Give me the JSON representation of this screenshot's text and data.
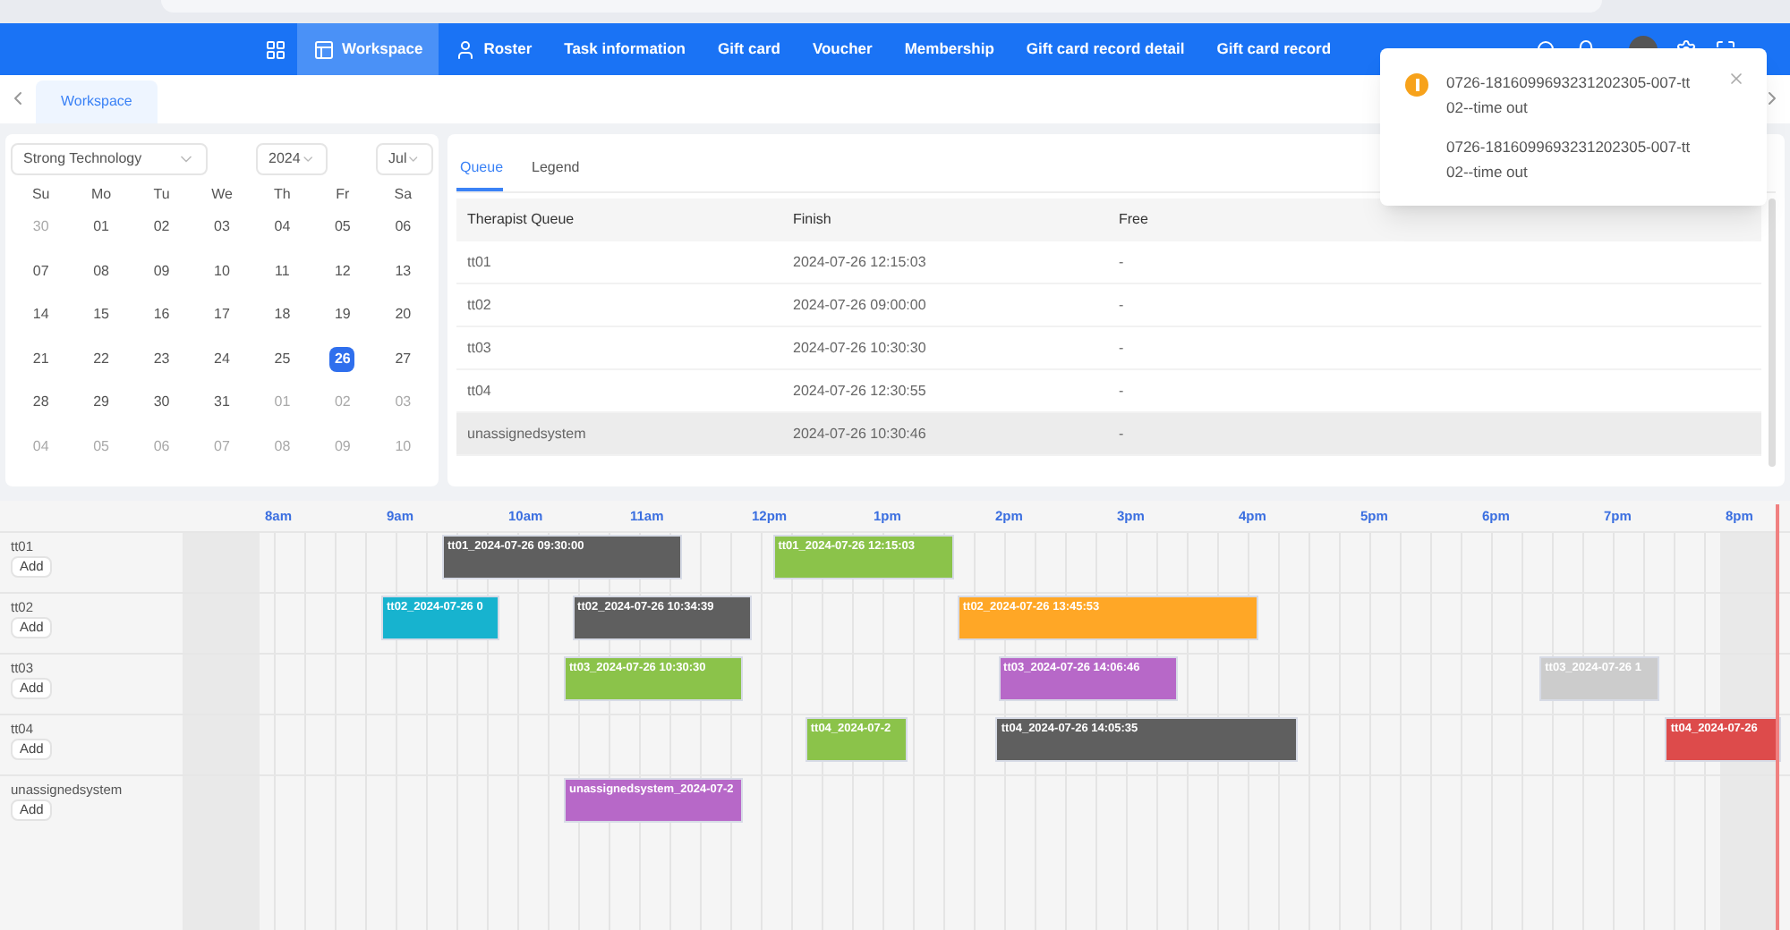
{
  "nav": {
    "items": [
      {
        "label": "Workspace",
        "selected": true,
        "kind": "panel"
      },
      {
        "label": "Roster",
        "selected": false,
        "kind": "person"
      },
      {
        "label": "Task information",
        "selected": false,
        "kind": "plain"
      },
      {
        "label": "Gift card",
        "selected": false,
        "kind": "plain"
      },
      {
        "label": "Voucher",
        "selected": false,
        "kind": "plain"
      },
      {
        "label": "Membership",
        "selected": false,
        "kind": "plain"
      },
      {
        "label": "Gift card record detail",
        "selected": false,
        "kind": "plain"
      },
      {
        "label": "Gift card record",
        "selected": false,
        "kind": "plain"
      }
    ]
  },
  "page_tabs": [
    {
      "label": "Workspace",
      "selected": true
    }
  ],
  "calendar": {
    "store": "Strong Technology",
    "year": "2024",
    "month": "Jul",
    "weekdays": [
      "Su",
      "Mo",
      "Tu",
      "We",
      "Th",
      "Fr",
      "Sa"
    ],
    "weeks": [
      [
        {
          "day": "30",
          "muted": true,
          "selected": false
        },
        {
          "day": "01",
          "muted": false,
          "selected": false
        },
        {
          "day": "02",
          "muted": false,
          "selected": false
        },
        {
          "day": "03",
          "muted": false,
          "selected": false
        },
        {
          "day": "04",
          "muted": false,
          "selected": false
        },
        {
          "day": "05",
          "muted": false,
          "selected": false
        },
        {
          "day": "06",
          "muted": false,
          "selected": false
        }
      ],
      [
        {
          "day": "07",
          "muted": false,
          "selected": false
        },
        {
          "day": "08",
          "muted": false,
          "selected": false
        },
        {
          "day": "09",
          "muted": false,
          "selected": false
        },
        {
          "day": "10",
          "muted": false,
          "selected": false
        },
        {
          "day": "11",
          "muted": false,
          "selected": false
        },
        {
          "day": "12",
          "muted": false,
          "selected": false
        },
        {
          "day": "13",
          "muted": false,
          "selected": false
        }
      ],
      [
        {
          "day": "14",
          "muted": false,
          "selected": false
        },
        {
          "day": "15",
          "muted": false,
          "selected": false
        },
        {
          "day": "16",
          "muted": false,
          "selected": false
        },
        {
          "day": "17",
          "muted": false,
          "selected": false
        },
        {
          "day": "18",
          "muted": false,
          "selected": false
        },
        {
          "day": "19",
          "muted": false,
          "selected": false
        },
        {
          "day": "20",
          "muted": false,
          "selected": false
        }
      ],
      [
        {
          "day": "21",
          "muted": false,
          "selected": false
        },
        {
          "day": "22",
          "muted": false,
          "selected": false
        },
        {
          "day": "23",
          "muted": false,
          "selected": false
        },
        {
          "day": "24",
          "muted": false,
          "selected": false
        },
        {
          "day": "25",
          "muted": false,
          "selected": false
        },
        {
          "day": "26",
          "muted": false,
          "selected": true
        },
        {
          "day": "27",
          "muted": false,
          "selected": false
        }
      ],
      [
        {
          "day": "28",
          "muted": false,
          "selected": false
        },
        {
          "day": "29",
          "muted": false,
          "selected": false
        },
        {
          "day": "30",
          "muted": false,
          "selected": false
        },
        {
          "day": "31",
          "muted": false,
          "selected": false
        },
        {
          "day": "01",
          "muted": true,
          "selected": false
        },
        {
          "day": "02",
          "muted": true,
          "selected": false
        },
        {
          "day": "03",
          "muted": true,
          "selected": false
        }
      ],
      [
        {
          "day": "04",
          "muted": true,
          "selected": false
        },
        {
          "day": "05",
          "muted": true,
          "selected": false
        },
        {
          "day": "06",
          "muted": true,
          "selected": false
        },
        {
          "day": "07",
          "muted": true,
          "selected": false
        },
        {
          "day": "08",
          "muted": true,
          "selected": false
        },
        {
          "day": "09",
          "muted": true,
          "selected": false
        },
        {
          "day": "10",
          "muted": true,
          "selected": false
        }
      ]
    ]
  },
  "queue": {
    "tabs": [
      {
        "label": "Queue",
        "selected": true
      },
      {
        "label": "Legend",
        "selected": false
      }
    ],
    "columns": [
      "Therapist Queue",
      "Finish",
      "Free"
    ],
    "rows": [
      {
        "cells": [
          "tt01",
          "2024-07-26 12:15:03",
          "-"
        ],
        "highlighted": false
      },
      {
        "cells": [
          "tt02",
          "2024-07-26 09:00:00",
          "-"
        ],
        "highlighted": false
      },
      {
        "cells": [
          "tt03",
          "2024-07-26 10:30:30",
          "-"
        ],
        "highlighted": false
      },
      {
        "cells": [
          "tt04",
          "2024-07-26 12:30:55",
          "-"
        ],
        "highlighted": false
      },
      {
        "cells": [
          "unassignedsystem",
          "2024-07-26 10:30:46",
          "-"
        ],
        "highlighted": true
      }
    ]
  },
  "timeline": {
    "hours": [
      "8am",
      "9am",
      "10am",
      "11am",
      "12pm",
      "1pm",
      "2pm",
      "3pm",
      "4pm",
      "5pm",
      "6pm",
      "7pm",
      "8pm"
    ],
    "rows": [
      {
        "name": "tt01",
        "bookings": [
          {
            "label": "tt01_2024-07-26 09:30:00",
            "color": "#5f5f5f"
          },
          {
            "label": "tt01_2024-07-26 12:15:03",
            "color": "#8bc34a"
          }
        ],
        "add_label": "Add"
      },
      {
        "name": "tt02",
        "bookings": [
          {
            "label": "tt02_2024-07-26 0",
            "color": "#17b3cf"
          },
          {
            "label": "tt02_2024-07-26 10:34:39",
            "color": "#5f5f5f"
          },
          {
            "label": "tt02_2024-07-26 13:45:53",
            "color": "#ffa726"
          }
        ],
        "add_label": "Add"
      },
      {
        "name": "tt03",
        "bookings": [
          {
            "label": "tt03_2024-07-26 10:30:30",
            "color": "#8bc34a"
          },
          {
            "label": "tt03_2024-07-26 14:06:46",
            "color": "#b768c8"
          },
          {
            "label": "tt03_2024-07-26 1",
            "color": "#cccccc"
          }
        ],
        "add_label": "Add"
      },
      {
        "name": "tt04",
        "bookings": [
          {
            "label": "tt04_2024-07-2",
            "color": "#8bc34a"
          },
          {
            "label": "tt04_2024-07-26 14:05:35",
            "color": "#5f5f5f"
          },
          {
            "label": "tt04_2024-07-26",
            "color": "#dd4b4b"
          }
        ],
        "add_label": "Add"
      },
      {
        "name": "unassignedsystem",
        "bookings": [
          {
            "label": "unassignedsystem_2024-07-2",
            "color": "#b768c8"
          }
        ],
        "add_label": "Add"
      }
    ]
  },
  "notification": {
    "messages": [
      "0726-1816099693231202305-007-tt02--time out",
      "0726-1816099693231202305-007-tt02--time out"
    ]
  }
}
